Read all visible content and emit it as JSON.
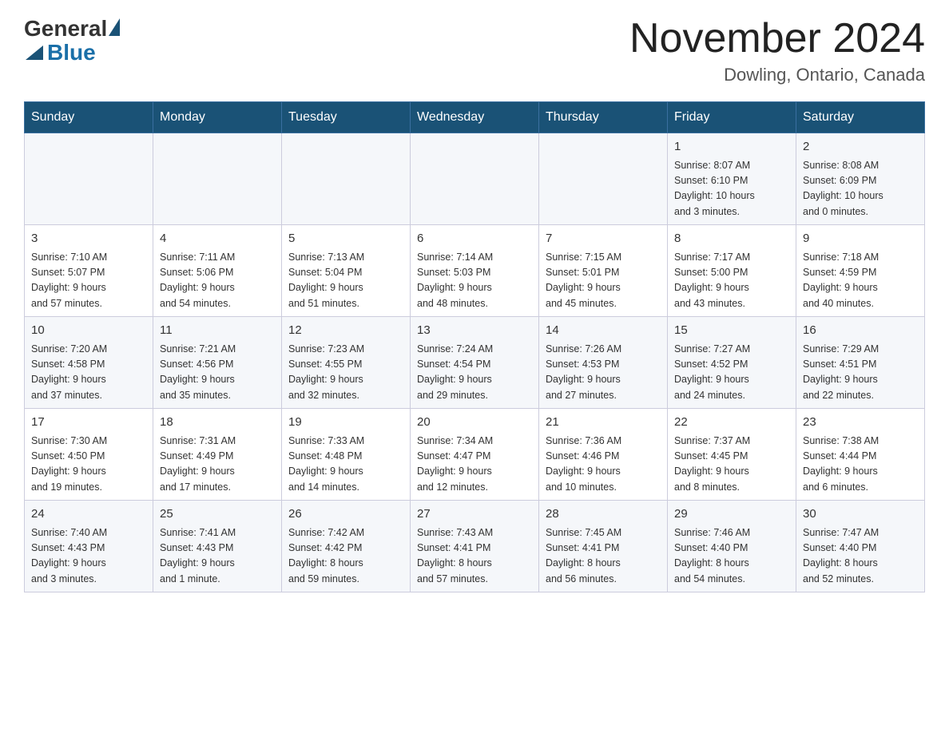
{
  "header": {
    "logo_general": "General",
    "logo_blue": "Blue",
    "month_title": "November 2024",
    "location": "Dowling, Ontario, Canada"
  },
  "weekdays": [
    "Sunday",
    "Monday",
    "Tuesday",
    "Wednesday",
    "Thursday",
    "Friday",
    "Saturday"
  ],
  "weeks": [
    [
      {
        "day": "",
        "info": ""
      },
      {
        "day": "",
        "info": ""
      },
      {
        "day": "",
        "info": ""
      },
      {
        "day": "",
        "info": ""
      },
      {
        "day": "",
        "info": ""
      },
      {
        "day": "1",
        "info": "Sunrise: 8:07 AM\nSunset: 6:10 PM\nDaylight: 10 hours\nand 3 minutes."
      },
      {
        "day": "2",
        "info": "Sunrise: 8:08 AM\nSunset: 6:09 PM\nDaylight: 10 hours\nand 0 minutes."
      }
    ],
    [
      {
        "day": "3",
        "info": "Sunrise: 7:10 AM\nSunset: 5:07 PM\nDaylight: 9 hours\nand 57 minutes."
      },
      {
        "day": "4",
        "info": "Sunrise: 7:11 AM\nSunset: 5:06 PM\nDaylight: 9 hours\nand 54 minutes."
      },
      {
        "day": "5",
        "info": "Sunrise: 7:13 AM\nSunset: 5:04 PM\nDaylight: 9 hours\nand 51 minutes."
      },
      {
        "day": "6",
        "info": "Sunrise: 7:14 AM\nSunset: 5:03 PM\nDaylight: 9 hours\nand 48 minutes."
      },
      {
        "day": "7",
        "info": "Sunrise: 7:15 AM\nSunset: 5:01 PM\nDaylight: 9 hours\nand 45 minutes."
      },
      {
        "day": "8",
        "info": "Sunrise: 7:17 AM\nSunset: 5:00 PM\nDaylight: 9 hours\nand 43 minutes."
      },
      {
        "day": "9",
        "info": "Sunrise: 7:18 AM\nSunset: 4:59 PM\nDaylight: 9 hours\nand 40 minutes."
      }
    ],
    [
      {
        "day": "10",
        "info": "Sunrise: 7:20 AM\nSunset: 4:58 PM\nDaylight: 9 hours\nand 37 minutes."
      },
      {
        "day": "11",
        "info": "Sunrise: 7:21 AM\nSunset: 4:56 PM\nDaylight: 9 hours\nand 35 minutes."
      },
      {
        "day": "12",
        "info": "Sunrise: 7:23 AM\nSunset: 4:55 PM\nDaylight: 9 hours\nand 32 minutes."
      },
      {
        "day": "13",
        "info": "Sunrise: 7:24 AM\nSunset: 4:54 PM\nDaylight: 9 hours\nand 29 minutes."
      },
      {
        "day": "14",
        "info": "Sunrise: 7:26 AM\nSunset: 4:53 PM\nDaylight: 9 hours\nand 27 minutes."
      },
      {
        "day": "15",
        "info": "Sunrise: 7:27 AM\nSunset: 4:52 PM\nDaylight: 9 hours\nand 24 minutes."
      },
      {
        "day": "16",
        "info": "Sunrise: 7:29 AM\nSunset: 4:51 PM\nDaylight: 9 hours\nand 22 minutes."
      }
    ],
    [
      {
        "day": "17",
        "info": "Sunrise: 7:30 AM\nSunset: 4:50 PM\nDaylight: 9 hours\nand 19 minutes."
      },
      {
        "day": "18",
        "info": "Sunrise: 7:31 AM\nSunset: 4:49 PM\nDaylight: 9 hours\nand 17 minutes."
      },
      {
        "day": "19",
        "info": "Sunrise: 7:33 AM\nSunset: 4:48 PM\nDaylight: 9 hours\nand 14 minutes."
      },
      {
        "day": "20",
        "info": "Sunrise: 7:34 AM\nSunset: 4:47 PM\nDaylight: 9 hours\nand 12 minutes."
      },
      {
        "day": "21",
        "info": "Sunrise: 7:36 AM\nSunset: 4:46 PM\nDaylight: 9 hours\nand 10 minutes."
      },
      {
        "day": "22",
        "info": "Sunrise: 7:37 AM\nSunset: 4:45 PM\nDaylight: 9 hours\nand 8 minutes."
      },
      {
        "day": "23",
        "info": "Sunrise: 7:38 AM\nSunset: 4:44 PM\nDaylight: 9 hours\nand 6 minutes."
      }
    ],
    [
      {
        "day": "24",
        "info": "Sunrise: 7:40 AM\nSunset: 4:43 PM\nDaylight: 9 hours\nand 3 minutes."
      },
      {
        "day": "25",
        "info": "Sunrise: 7:41 AM\nSunset: 4:43 PM\nDaylight: 9 hours\nand 1 minute."
      },
      {
        "day": "26",
        "info": "Sunrise: 7:42 AM\nSunset: 4:42 PM\nDaylight: 8 hours\nand 59 minutes."
      },
      {
        "day": "27",
        "info": "Sunrise: 7:43 AM\nSunset: 4:41 PM\nDaylight: 8 hours\nand 57 minutes."
      },
      {
        "day": "28",
        "info": "Sunrise: 7:45 AM\nSunset: 4:41 PM\nDaylight: 8 hours\nand 56 minutes."
      },
      {
        "day": "29",
        "info": "Sunrise: 7:46 AM\nSunset: 4:40 PM\nDaylight: 8 hours\nand 54 minutes."
      },
      {
        "day": "30",
        "info": "Sunrise: 7:47 AM\nSunset: 4:40 PM\nDaylight: 8 hours\nand 52 minutes."
      }
    ]
  ]
}
